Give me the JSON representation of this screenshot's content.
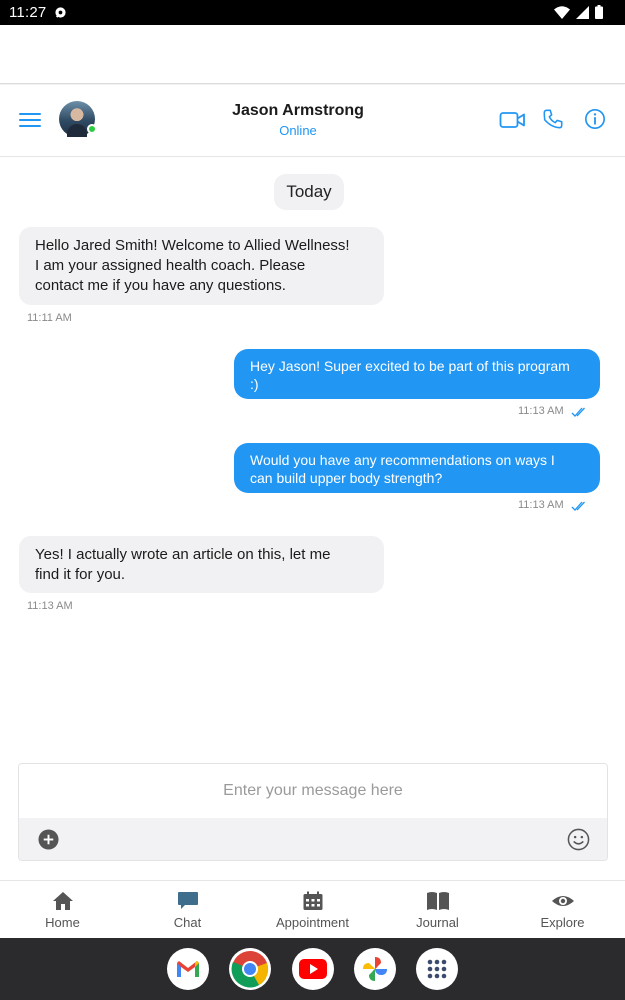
{
  "status_bar": {
    "time": "11:27"
  },
  "header": {
    "contact_name": "Jason Armstrong",
    "contact_status": "Online"
  },
  "chat": {
    "date_label": "Today",
    "messages": [
      {
        "direction": "incoming",
        "text_lines": [
          "Hello Jared Smith! Welcome to Allied Wellness!",
          "I am your assigned health coach. Please",
          "contact me if you have any questions."
        ],
        "time": "11:11 AM"
      },
      {
        "direction": "outgoing",
        "text_lines": [
          "Hey Jason! Super excited to be part of this program",
          ":)"
        ],
        "time": "11:13 AM"
      },
      {
        "direction": "outgoing",
        "text_lines": [
          "Would you have any recommendations on ways I",
          "can build upper body strength?"
        ],
        "time": "11:13 AM"
      },
      {
        "direction": "incoming",
        "text_lines": [
          "Yes! I actually wrote an article on this, let me",
          "find it for you."
        ],
        "time": "11:13 AM"
      }
    ]
  },
  "composer": {
    "placeholder": "Enter your message here"
  },
  "bottom_nav": {
    "items": [
      {
        "label": "Home",
        "icon": "home-icon"
      },
      {
        "label": "Chat",
        "icon": "chat-icon",
        "active": true
      },
      {
        "label": "Appointment",
        "icon": "calendar-icon"
      },
      {
        "label": "Journal",
        "icon": "book-icon"
      },
      {
        "label": "Explore",
        "icon": "eye-icon"
      }
    ]
  },
  "dock": {
    "apps": [
      "gmail-icon",
      "chrome-icon",
      "youtube-icon",
      "photos-icon",
      "app-drawer-icon"
    ]
  },
  "colors": {
    "accent": "#2196f3",
    "online": "#2ecc40",
    "incoming_bubble": "#f1f1f3",
    "outgoing_bubble": "#2196f3",
    "dock": "#2b2b2d"
  }
}
